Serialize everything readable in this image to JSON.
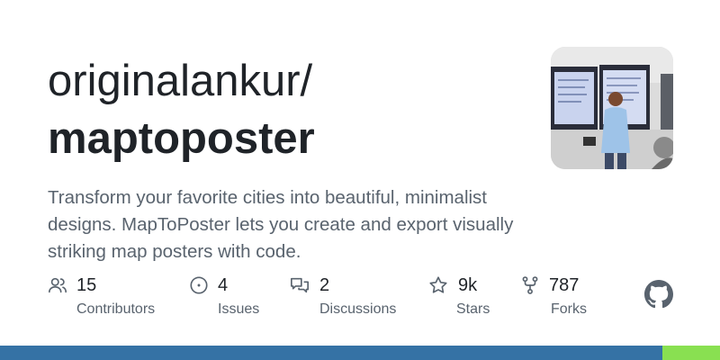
{
  "repo": {
    "owner": "originalankur/",
    "name": "maptoposter",
    "description": "Transform your favorite cities into beautiful, minimalist designs. MapToPoster lets you create and export visually striking map posters with code."
  },
  "stats": [
    {
      "icon": "people-icon",
      "value": "15",
      "label": "Contributors"
    },
    {
      "icon": "issue-icon",
      "value": "4",
      "label": "Issues"
    },
    {
      "icon": "discussion-icon",
      "value": "2",
      "label": "Discussions"
    },
    {
      "icon": "star-icon",
      "value": "9k",
      "label": "Stars"
    },
    {
      "icon": "fork-icon",
      "value": "787",
      "label": "Forks"
    }
  ],
  "language_bar": [
    {
      "color": "#3572a5",
      "fraction": 0.92
    },
    {
      "color": "#89e051",
      "fraction": 0.08
    }
  ],
  "colors": {
    "text": "#1f2328",
    "muted": "#59636e"
  }
}
